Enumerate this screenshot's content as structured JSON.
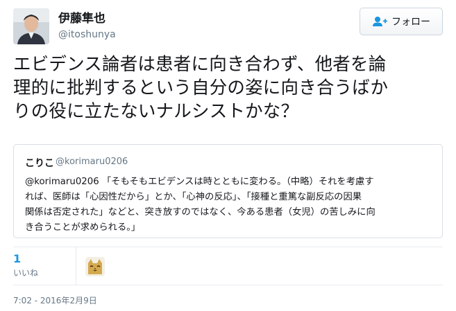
{
  "user": {
    "display_name": "伊藤隼也",
    "handle": "@itoshunya"
  },
  "follow_button": {
    "label": "フォロー",
    "icon": "add-user-icon"
  },
  "tweet": {
    "lines": [
      "エビデンス論者は患者に向き合わず、他者を論",
      "理的に批判するという自分の姿に向き合うばか",
      "りの役に立たないナルシストかな？"
    ]
  },
  "quoted_tweet": {
    "display_name": "こりこ",
    "handle": "@korimaru0206",
    "lines": [
      "@korimaru0206 「そもそもエビデンスは時とともに変わる。（中略）それを考慮す",
      "れば、医師は「心因性だから」とか、「心神の反応」、「接種と重篤な副反応の因果",
      "関係は否定された」などと、突き放すのではなく、今ある患者（女児）の苦しみに向",
      "き合うことが求められる。」"
    ]
  },
  "stats": {
    "likes_count": "1",
    "likes_label": "いいね"
  },
  "timestamp": "7:02 - 2016年2月9日",
  "colors": {
    "link_blue": "#1b95e0",
    "secondary_text": "#657786",
    "border": "#e6ecf0"
  }
}
